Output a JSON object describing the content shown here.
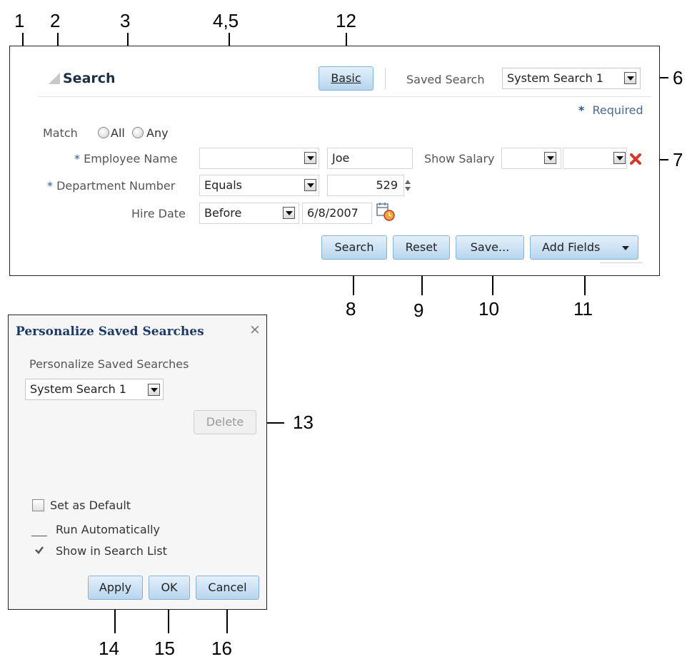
{
  "callouts": [
    "1",
    "2",
    "3",
    "4,5",
    "12",
    "6",
    "7",
    "8",
    "9",
    "10",
    "11",
    "13",
    "14",
    "15",
    "16"
  ],
  "search_panel": {
    "title": "Search",
    "basic_button": "Basic",
    "saved_search_label": "Saved Search",
    "saved_search_value": "System Search 1",
    "required_marker": "*",
    "required_label": "Required",
    "match_label": "Match",
    "match_options": [
      "All",
      "Any"
    ],
    "fields": {
      "employee_name": {
        "label": "Employee Name",
        "operator": "",
        "value": "Joe"
      },
      "show_salary": {
        "label": "Show Salary",
        "operator": "",
        "value": ""
      },
      "department_number": {
        "label": "Department Number",
        "operator": "Equals",
        "value": "529"
      },
      "hire_date": {
        "label": "Hire Date",
        "operator": "Before",
        "value": "6/8/2007"
      }
    },
    "buttons": {
      "search": "Search",
      "reset": "Reset",
      "save": "Save...",
      "add_fields": "Add Fields"
    }
  },
  "personalize_dialog": {
    "title": "Personalize Saved Searches",
    "close_glyph": "×",
    "section_label": "Personalize Saved Searches",
    "selected_search": "System Search 1",
    "delete_button": "Delete",
    "set_as_default": "Set as Default",
    "run_automatically": "Run Automatically",
    "show_in_search_list": "Show in Search List",
    "buttons": {
      "apply": "Apply",
      "ok": "OK",
      "cancel": "Cancel"
    }
  },
  "icons": [
    "triangle-disclosure-icon",
    "dropdown-arrow-icon",
    "spinner-icon",
    "calendar-icon",
    "remove-field-icon",
    "checkmark-icon",
    "close-icon"
  ],
  "colors": {
    "accent": "#2b5797",
    "button_fill": "#c9e0f4",
    "button_border": "#86b2d6",
    "remove_icon": "#d9362a"
  }
}
